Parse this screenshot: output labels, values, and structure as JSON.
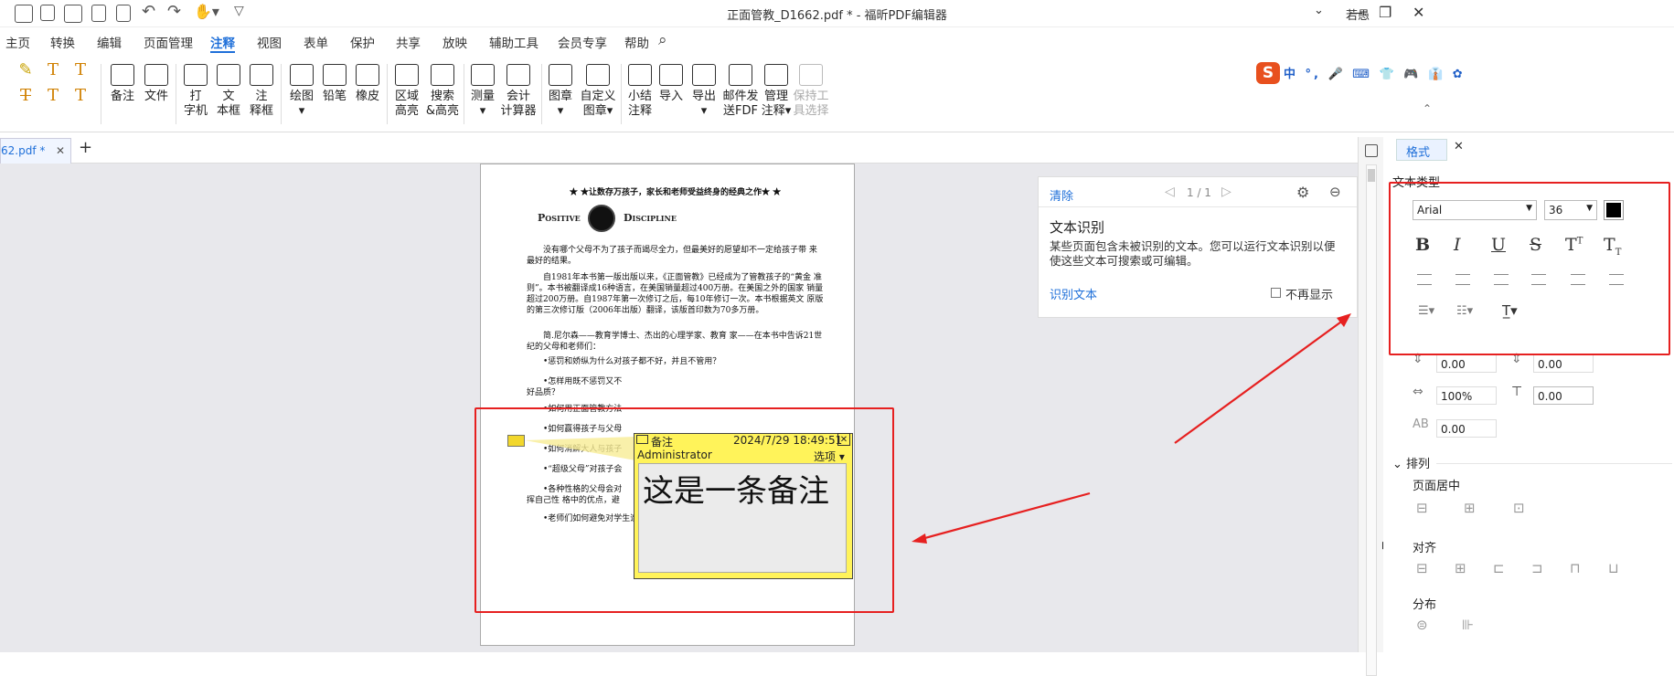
{
  "title_bar": {
    "document_title": "正面管教_D1662.pdf * - 福昕PDF编辑器",
    "user_name": "若愚"
  },
  "menu": [
    "主页",
    "转换",
    "编辑",
    "页面管理",
    "注释",
    "视图",
    "表单",
    "保护",
    "共享",
    "放映",
    "辅助工具",
    "会员专享",
    "帮助"
  ],
  "menu_active": "注释",
  "ribbon": {
    "text_tools_1": [
      "T",
      "T",
      "T"
    ],
    "text_tools_2": [
      "T",
      "T",
      "T"
    ],
    "buttons": [
      {
        "label": "备注",
        "icon": "note-icon"
      },
      {
        "label": "文件",
        "icon": "file-attach-icon"
      },
      {
        "label": "打\n字机",
        "icon": "typewriter-icon"
      },
      {
        "label": "文\n本框",
        "icon": "textbox-icon"
      },
      {
        "label": "注\n释框",
        "icon": "callout-icon"
      },
      {
        "label": "绘图\n▾",
        "icon": "rectangle-icon"
      },
      {
        "label": "铅笔",
        "icon": "pencil-icon"
      },
      {
        "label": "橡皮",
        "icon": "eraser-icon"
      },
      {
        "label": "区域\n高亮",
        "icon": "area-highlight-icon"
      },
      {
        "label": "搜索\n&高亮",
        "icon": "search-highlight-icon"
      },
      {
        "label": "测量\n▾",
        "icon": "ruler-icon"
      },
      {
        "label": "会计\n计算器",
        "icon": "calculator-icon"
      },
      {
        "label": "图章\n▾",
        "icon": "stamp-icon"
      },
      {
        "label": "自定义\n图章▾",
        "icon": "custom-stamp-icon"
      },
      {
        "label": "小结\n注释",
        "icon": "summary-icon"
      },
      {
        "label": "导入",
        "icon": "import-icon"
      },
      {
        "label": "导出\n▾",
        "icon": "export-icon"
      },
      {
        "label": "邮件发\n送FDF",
        "icon": "email-icon"
      },
      {
        "label": "管理\n注释▾",
        "icon": "manage-comments-icon"
      },
      {
        "label": "保持工\n具选择",
        "icon": "pin-icon",
        "disabled": true
      }
    ],
    "ime_bar": [
      "中",
      "°,",
      "🎤",
      "⌨",
      "👕",
      "🎮",
      "👔",
      "✿"
    ]
  },
  "tab": {
    "name": "62.pdf *",
    "close": "✕",
    "add": "+"
  },
  "pdf_page": {
    "banner": "★ ★让数存万孩子，家长和老师受益终身的经典之作★ ★",
    "logo_left": "Positive",
    "logo_right": "Discipline",
    "para1": "没有哪个父母不为了孩子而竭尽全力，但最美好的愿望却不一定给孩子带 来最好的结果。",
    "para2": "自1981年本书第一版出版以来，《正面管教》已经成为了管教孩子的“黄金 准则”。本书被翻译成16种语言，在美国销量超过400万册。在美国之外的国家 销量超过200万册。自1987年第一次修订之后，每10年修订一次。本书根据英文 原版的第三次修订版（2006年出版）翻译，该版首印数为70多万册。",
    "para3": "简.尼尔森——教育学博士、杰出的心理学家、教育 家——在本书中告诉21世纪的父母和老师们：",
    "bullet1": "•惩罚和娇纵为什么对孩子都不好，并且不管用？",
    "bullet2": "•怎样用既不惩罚又不",
    "bullet2b": "好品质？",
    "bullet3": "•如何用正面管教方法",
    "bullet4": "•如何赢得孩子与父母",
    "bullet5": "•如何消解大人与孩子",
    "bullet6": "•“超级父母”对孩子会",
    "bullet7": "•各种性格的父母会对",
    "bullet7b": "挥自己性 格中的优点，避",
    "bullet8": "•老师们如何避免对学生造成管教问题？"
  },
  "note_popup": {
    "label": "备注",
    "date": "2024/7/29 18:49:51",
    "close": "✕",
    "author": "Administrator",
    "options": "选项 ▾",
    "content": "这是一条备注"
  },
  "recognition_panel": {
    "clear": "清除",
    "page": "1 / 1",
    "heading": "文本识别",
    "description": "某些页面包含未被识别的文本。您可以运行文本识别以便使这些文本可搜索或可编辑。",
    "action": "识别文本",
    "dont_show": "不再显示"
  },
  "format_panel": {
    "tab_label": "格式",
    "tab_close": "✕",
    "section_text_type": "文本类型",
    "font": "Arial",
    "font_size": "36",
    "font_color": "#000000",
    "style_buttons": [
      "B",
      "I",
      "U",
      "S",
      "T",
      "T"
    ],
    "spacing_values": [
      "0.00",
      "0.00",
      "100%",
      "0.00",
      "0.00"
    ],
    "section_arrange": "排列",
    "page_center": "页面居中",
    "align_label": "对齐",
    "distribute_label": "分布"
  },
  "colors": {
    "accent": "#1e6fd9",
    "annotation_red": "#e62020",
    "note_yellow": "#fff35a"
  }
}
